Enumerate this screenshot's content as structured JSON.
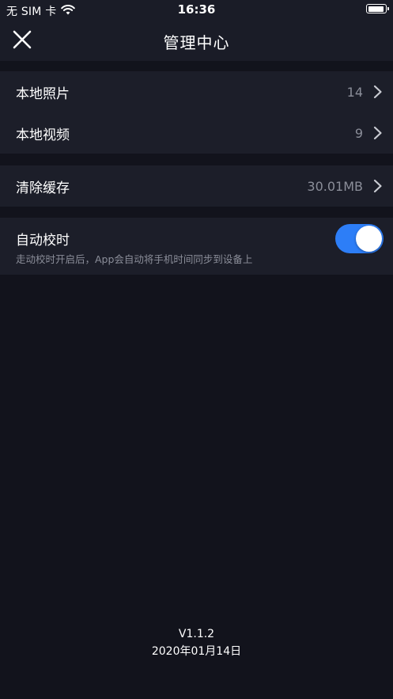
{
  "status_bar": {
    "carrier": "无 SIM 卡",
    "time": "16:36",
    "wifi_icon": "wifi-icon",
    "battery_icon": "battery-icon"
  },
  "nav": {
    "title": "管理中心",
    "close_icon": "close-icon"
  },
  "media_group": {
    "items": [
      {
        "label": "本地照片",
        "value": "14"
      },
      {
        "label": "本地视频",
        "value": "9"
      }
    ]
  },
  "cache_group": {
    "label": "清除缓存",
    "value": "30.01MB"
  },
  "auto_sync": {
    "label": "自动校时",
    "description": "走动校时开启后，App会自动将手机时间同步到设备上",
    "enabled": true
  },
  "footer": {
    "version": "V1.1.2",
    "date": "2020年01月14日"
  },
  "colors": {
    "background": "#12131c",
    "panel": "#1c1e29",
    "accent": "#2d7ef7",
    "secondary_text": "#8b8e99"
  }
}
